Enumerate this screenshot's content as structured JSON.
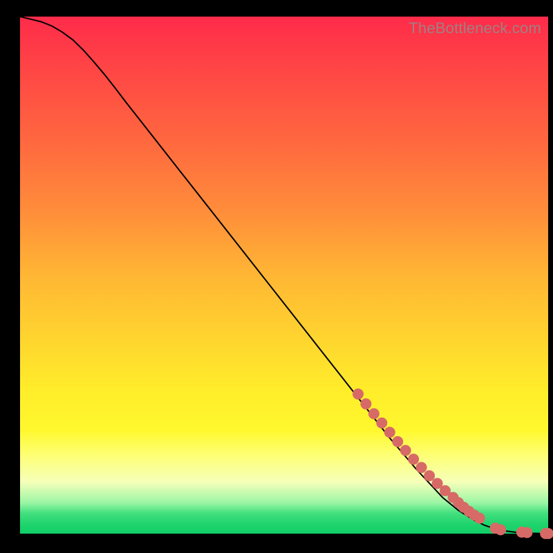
{
  "watermark": "TheBottleneck.com",
  "colors": {
    "dot": "#d76a66",
    "line": "#000000"
  },
  "chart_data": {
    "type": "line",
    "title": "",
    "xlabel": "",
    "ylabel": "",
    "xlim": [
      0,
      100
    ],
    "ylim": [
      0,
      100
    ],
    "grid": false,
    "series": [
      {
        "name": "curve",
        "x": [
          0,
          2,
          4,
          6,
          8,
          10,
          12,
          14,
          16,
          18,
          20,
          25,
          30,
          35,
          40,
          45,
          50,
          55,
          60,
          65,
          70,
          75,
          80,
          83,
          86,
          88,
          90,
          92,
          94,
          96,
          98,
          100
        ],
        "y": [
          100,
          99.5,
          99,
          98.2,
          97,
          95.5,
          93.5,
          91.2,
          88.8,
          86.2,
          83.5,
          77,
          70.5,
          64,
          57.5,
          51,
          44.5,
          38,
          31.5,
          25,
          18.5,
          12.5,
          7,
          4.5,
          2.6,
          1.6,
          0.9,
          0.5,
          0.25,
          0.1,
          0.05,
          0
        ]
      }
    ],
    "dots": {
      "name": "highlighted-range",
      "x": [
        64,
        65.5,
        67,
        68.5,
        70,
        71.5,
        73,
        74.5,
        76,
        77.5,
        79,
        80.5,
        82,
        83,
        84,
        85,
        86,
        87,
        90,
        91,
        95,
        96,
        99.5,
        100
      ],
      "y": [
        27,
        25.1,
        23.2,
        21.4,
        19.6,
        17.8,
        16.1,
        14.4,
        12.8,
        11.2,
        9.7,
        8.3,
        7.0,
        6.0,
        5.1,
        4.3,
        3.6,
        3.0,
        1.05,
        0.75,
        0.3,
        0.22,
        0.03,
        0.02
      ]
    }
  }
}
